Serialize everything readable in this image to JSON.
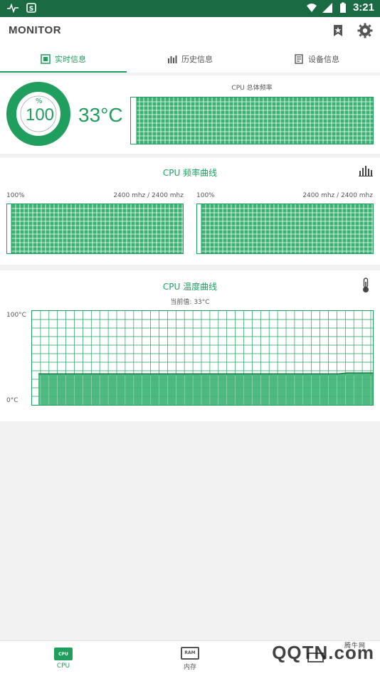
{
  "status_bar": {
    "time": "3:21"
  },
  "app_bar": {
    "title": "MONITOR"
  },
  "tabs": [
    {
      "label": "实时信息",
      "active": true
    },
    {
      "label": "历史信息",
      "active": false
    },
    {
      "label": "设备信息",
      "active": false
    }
  ],
  "realtime": {
    "usage_unit": "%",
    "usage_value": "100",
    "usage_fraction": 1.0,
    "temperature": "33°C",
    "total_freq_title": "CPU 总体频率"
  },
  "freq_curve": {
    "title": "CPU 频率曲线",
    "cores": [
      {
        "percent": "100%",
        "freq": "2400 mhz / 2400 mhz"
      },
      {
        "percent": "100%",
        "freq": "2400 mhz / 2400 mhz"
      }
    ]
  },
  "temp_curve": {
    "title": "CPU 温度曲线",
    "current": "当前值: 33°C",
    "y_max_label": "100°C",
    "y_min_label": "0°C"
  },
  "chart_data": {
    "type": "area",
    "ylabel": "",
    "ylim": [
      0,
      100
    ],
    "values": [
      33,
      33,
      33,
      33,
      33,
      33,
      33,
      33,
      33,
      33,
      33,
      33,
      33,
      33,
      33,
      33,
      33,
      33,
      33,
      33,
      33,
      33,
      33,
      33,
      33,
      33,
      33,
      33,
      33,
      33,
      33,
      33,
      33,
      33,
      33,
      33,
      34,
      34,
      34,
      34
    ]
  },
  "bottom_nav": [
    {
      "label": "CPU",
      "chip": "CPU",
      "active": true
    },
    {
      "label": "内存",
      "chip": "RAM",
      "active": false
    },
    {
      "label": "",
      "chip": "",
      "active": false
    }
  ],
  "watermark": {
    "text": "QQTN.com",
    "sub": "腾牛网"
  },
  "colors": {
    "accent": "#1f9e5e",
    "status_bar": "#1a6b43",
    "fill": "#3bb273"
  }
}
